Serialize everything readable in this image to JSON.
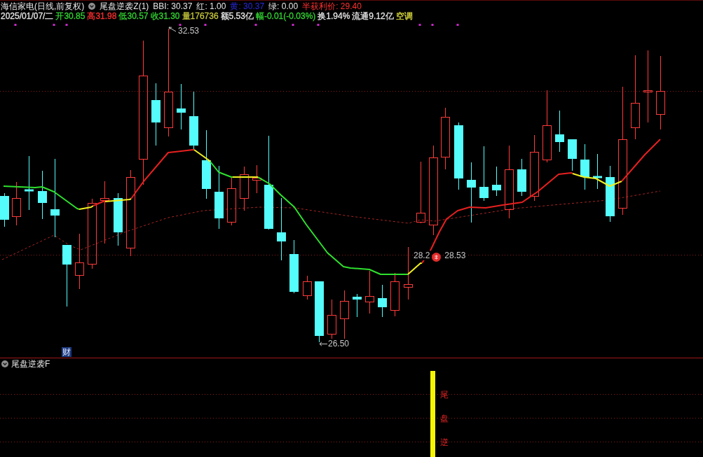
{
  "title_bar": {
    "security": "海信家电(日线,前复权)",
    "indicator": "尾盘逆袭Z(1)",
    "readings": [
      {
        "text": "BBI: 30.37",
        "color": "#e6e6e6"
      },
      {
        "text": "红: 1.00",
        "color": "#e6e6e6"
      },
      {
        "text": "黄: 30.37",
        "color": "#2a2ae0"
      },
      {
        "text": "绿: 0.00",
        "color": "#e6e6e6"
      },
      {
        "text": "半获利价: 29.40",
        "color": "#ff3030"
      }
    ]
  },
  "quote_bar": [
    {
      "text": "2025/01/07/二",
      "color": "#e6e6e6"
    },
    {
      "text": "开30.85",
      "color": "#33d633"
    },
    {
      "text": "高31.98",
      "color": "#ff3030"
    },
    {
      "text": "低30.57",
      "color": "#33d633"
    },
    {
      "text": "收31.30",
      "color": "#33d633"
    },
    {
      "text": "量176736",
      "color": "#c8c83c"
    },
    {
      "text": "额5.53亿",
      "color": "#e6e6e6"
    },
    {
      "text": "幅-0.01(-0.03%)",
      "color": "#33d633"
    },
    {
      "text": "换1.94%",
      "color": "#e6e6e6"
    },
    {
      "text": "流通9.12亿",
      "color": "#e6e6e6"
    },
    {
      "text": "空调",
      "color": "#e0e040"
    }
  ],
  "main_chart": {
    "high_label": "32.53",
    "low_label": "26.50",
    "cross_labels": [
      "28.2",
      "28.53"
    ],
    "event_badge": "财"
  },
  "lower_panel": {
    "title": "尾盘逆袭F",
    "signal_chars": [
      "尾",
      "盘",
      "逆"
    ]
  }
}
